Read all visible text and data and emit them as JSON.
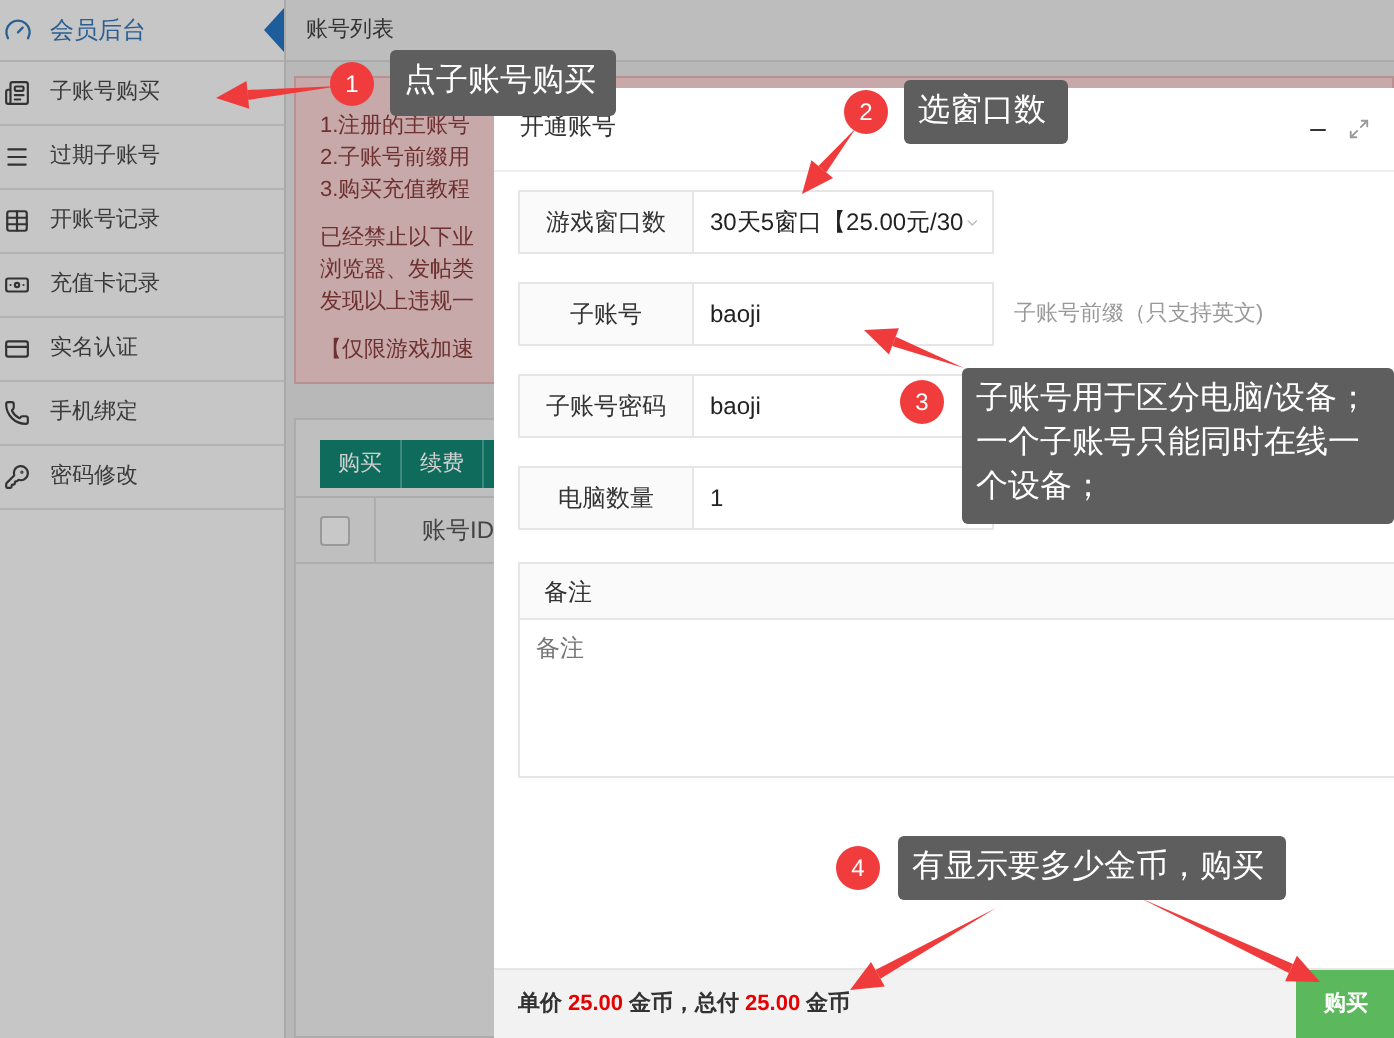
{
  "sidebar": {
    "header": "会员后台",
    "items": [
      "子账号购买",
      "过期子账号",
      "开账号记录",
      "充值卡记录",
      "实名认证",
      "手机绑定",
      "密码修改"
    ]
  },
  "page_header": "账号列表",
  "notice": {
    "paragraphs": [
      [
        "1.注册的主账号",
        "2.子账号前缀用",
        "3.购买充值教程"
      ],
      [
        "已经禁止以下业",
        "浏览器、发帖类",
        "发现以上违规一"
      ],
      [
        "【仅限游戏加速"
      ]
    ]
  },
  "toolbar": {
    "buttons": [
      "购买",
      "续费"
    ]
  },
  "table": {
    "select_all": {
      "checked": false
    },
    "columns": [
      "账号ID"
    ]
  },
  "dialog": {
    "title": "开通账号",
    "fields": [
      {
        "kind": "select",
        "label": "游戏窗口数",
        "value": "30天5窗口【25.00元/30"
      },
      {
        "kind": "input",
        "label": "子账号",
        "value": "baoji",
        "help": "子账号前缀（只支持英文)"
      },
      {
        "kind": "input",
        "label": "子账号密码",
        "value": "baoji"
      },
      {
        "kind": "input",
        "label": "电脑数量",
        "value": "1"
      }
    ],
    "remark": {
      "title": "备注",
      "placeholder": "备注"
    },
    "footer": [
      {
        "kind": "text",
        "text": "单价"
      },
      {
        "kind": "amount",
        "text": "25.00"
      },
      {
        "kind": "text",
        "text": "金币，总付"
      },
      {
        "kind": "amount",
        "text": "25.00"
      },
      {
        "kind": "text",
        "text": "金币"
      }
    ],
    "submit": "购买"
  },
  "annotations": [
    {
      "number": "1",
      "text": "点子账号购买"
    },
    {
      "number": "2",
      "text": "选窗口数"
    },
    {
      "number": "3",
      "text": "子账号用于区分电脑/设备；一个子账号只能同时在线一个设备；"
    },
    {
      "number": "4",
      "text": "有显示要多少金币，购买"
    }
  ]
}
